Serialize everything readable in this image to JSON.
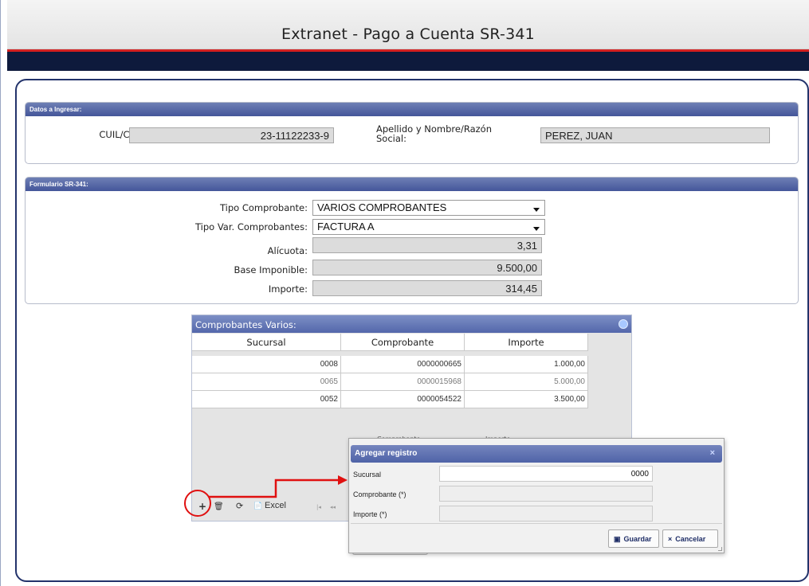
{
  "window": {
    "title": "Extranet - Pago a Cuenta SR-341"
  },
  "datos": {
    "header": "Datos a Ingresar:",
    "cuit_label": "CUIL/CUIT:",
    "cuit_value": "23-11122233-9",
    "nombre_label": "Apellido y Nombre/Razón Social:",
    "nombre_value": "PEREZ, JUAN"
  },
  "formulario": {
    "header": "Formulario SR-341:",
    "tipo_comprobante_label": "Tipo Comprobante:",
    "tipo_comprobante_value": "VARIOS COMPROBANTES",
    "tipo_var_label": "Tipo Var. Comprobantes:",
    "tipo_var_value": "FACTURA A",
    "alicuota_label": "Alícuota:",
    "alicuota_value": "3,31",
    "base_label": "Base Imponible:",
    "base_value": "9.500,00",
    "importe_label": "Importe:",
    "importe_value": "314,45"
  },
  "grid": {
    "title": "Comprobantes Varios:",
    "columns": [
      "Sucursal",
      "Comprobante",
      "Importe"
    ],
    "rows": [
      {
        "sucursal": "0008",
        "comprobante": "0000000665",
        "importe": "1.000,00"
      },
      {
        "sucursal": "0065",
        "comprobante": "0000015968",
        "importe": "5.000,00"
      },
      {
        "sucursal": "0052",
        "comprobante": "0000054522",
        "importe": "3.500,00"
      }
    ],
    "ghost_comprobante": "Comprobante",
    "ghost_importe": "Importe",
    "toolbar": {
      "add": "+",
      "delete": "🗑",
      "refresh": "⟳",
      "excel_icon": "📄",
      "excel": "Excel",
      "first": "|◂",
      "prev": "◂◂"
    }
  },
  "dialog": {
    "title": "Agregar registro",
    "close": "×",
    "sucursal_label": "Sucursal",
    "sucursal_value": "0000",
    "comprobante_label": "Comprobante (*)",
    "comprobante_value": "",
    "importe_label": "Importe (*)",
    "importe_value": "",
    "guardar": "Guardar",
    "cancelar": "Cancelar"
  },
  "colors": {
    "annotation": "#e01010",
    "header_navy": "#0e1a3c",
    "section_blue": "#4d5fa0",
    "title_red_line": "#d42020"
  }
}
